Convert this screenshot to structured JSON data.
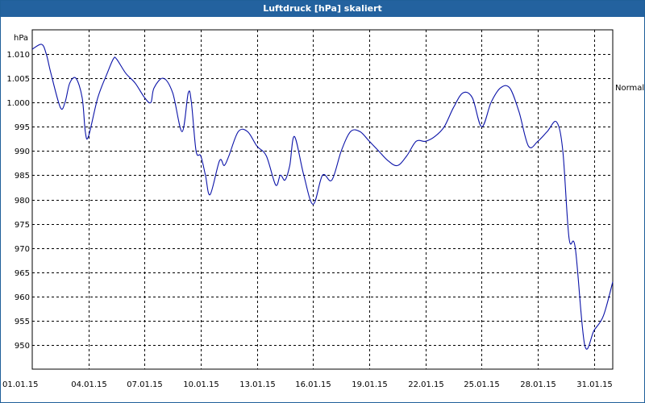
{
  "window": {
    "title": "Luftdruck [hPa] skaliert"
  },
  "colors": {
    "titlebar": "#23629f",
    "line": "#0b13a8",
    "grid": "#000000",
    "background": "#ffffff"
  },
  "chart_data": {
    "type": "line",
    "title": "Luftdruck [hPa] skaliert",
    "ylabel": "hPa",
    "right_label": "Normal",
    "grid": true,
    "grid_style": "dashed",
    "x_range": [
      "01.01.15",
      "01.02.15"
    ],
    "xtick_labels": [
      "01.01.15",
      "04.01.15",
      "07.01.15",
      "10.01.15",
      "13.01.15",
      "16.01.15",
      "19.01.15",
      "22.01.15",
      "25.01.15",
      "28.01.15",
      "31.01.15"
    ],
    "ylim": [
      945,
      1015
    ],
    "yticks": [
      950,
      955,
      960,
      965,
      970,
      975,
      980,
      985,
      990,
      995,
      1000,
      1005,
      1010
    ],
    "ytick_labels": [
      "950",
      "955",
      "960",
      "965",
      "970",
      "975",
      "980",
      "985",
      "990",
      "995",
      "1.000",
      "1.005",
      "1.010"
    ],
    "series": [
      {
        "x": [
          "01.01.15 00:00",
          "01.01.15 12:00",
          "01.01.15 18:00",
          "02.01.15 00:00",
          "02.01.15 12:00",
          "02.01.15 18:00",
          "03.01.15 00:00",
          "03.01.15 08:00",
          "03.01.15 16:00",
          "03.01.15 20:00",
          "04.01.15 00:00",
          "04.01.15 12:00",
          "05.01.15 00:00",
          "05.01.15 08:00",
          "05.01.15 12:00",
          "06.01.15 00:00",
          "06.01.15 12:00",
          "07.01.15 00:00",
          "07.01.15 08:00",
          "07.01.15 12:00",
          "08.01.15 00:00",
          "08.01.15 12:00",
          "09.01.15 00:00",
          "09.01.15 08:00",
          "09.01.15 12:00",
          "09.01.15 18:00",
          "10.01.15 00:00",
          "10.01.15 06:00",
          "10.01.15 12:00",
          "11.01.15 00:00",
          "11.01.15 06:00",
          "11.01.15 12:00",
          "12.01.15 00:00",
          "12.01.15 12:00",
          "13.01.15 00:00",
          "13.01.15 12:00",
          "14.01.15 00:00",
          "14.01.15 06:00",
          "14.01.15 12:00",
          "14.01.15 18:00",
          "15.01.15 00:00",
          "15.01.15 12:00",
          "16.01.15 00:00",
          "16.01.15 12:00",
          "17.01.15 00:00",
          "17.01.15 12:00",
          "18.01.15 00:00",
          "18.01.15 12:00",
          "19.01.15 00:00",
          "19.01.15 12:00",
          "20.01.15 00:00",
          "20.01.15 12:00",
          "21.01.15 00:00",
          "21.01.15 12:00",
          "22.01.15 00:00",
          "22.01.15 12:00",
          "23.01.15 00:00",
          "23.01.15 12:00",
          "24.01.15 00:00",
          "24.01.15 12:00",
          "25.01.15 00:00",
          "25.01.15 12:00",
          "26.01.15 00:00",
          "26.01.15 12:00",
          "27.01.15 00:00",
          "27.01.15 12:00",
          "28.01.15 00:00",
          "28.01.15 12:00",
          "29.01.15 00:00",
          "29.01.15 08:00",
          "29.01.15 16:00",
          "30.01.15 00:00",
          "30.01.15 12:00",
          "31.01.15 00:00",
          "31.01.15 12:00",
          "01.02.15 00:00"
        ],
        "y": [
          1011,
          1012,
          1010,
          1006,
          999,
          1000,
          1004,
          1005,
          1001,
          994,
          993,
          1001,
          1006,
          1009,
          1009,
          1006,
          1004,
          1001,
          1000,
          1003,
          1005,
          1002,
          994,
          1002,
          1000,
          990,
          989,
          985,
          981,
          988,
          987,
          989,
          994,
          994,
          991,
          989,
          983,
          985,
          984,
          987,
          993,
          985,
          979,
          985,
          984,
          990,
          994,
          994,
          992,
          990,
          988,
          987,
          989,
          992,
          992,
          993,
          995,
          999,
          1002,
          1001,
          995,
          1000,
          1003,
          1003,
          998,
          991,
          992,
          994,
          996,
          990,
          972,
          970,
          950,
          953,
          956,
          963
        ]
      }
    ]
  }
}
